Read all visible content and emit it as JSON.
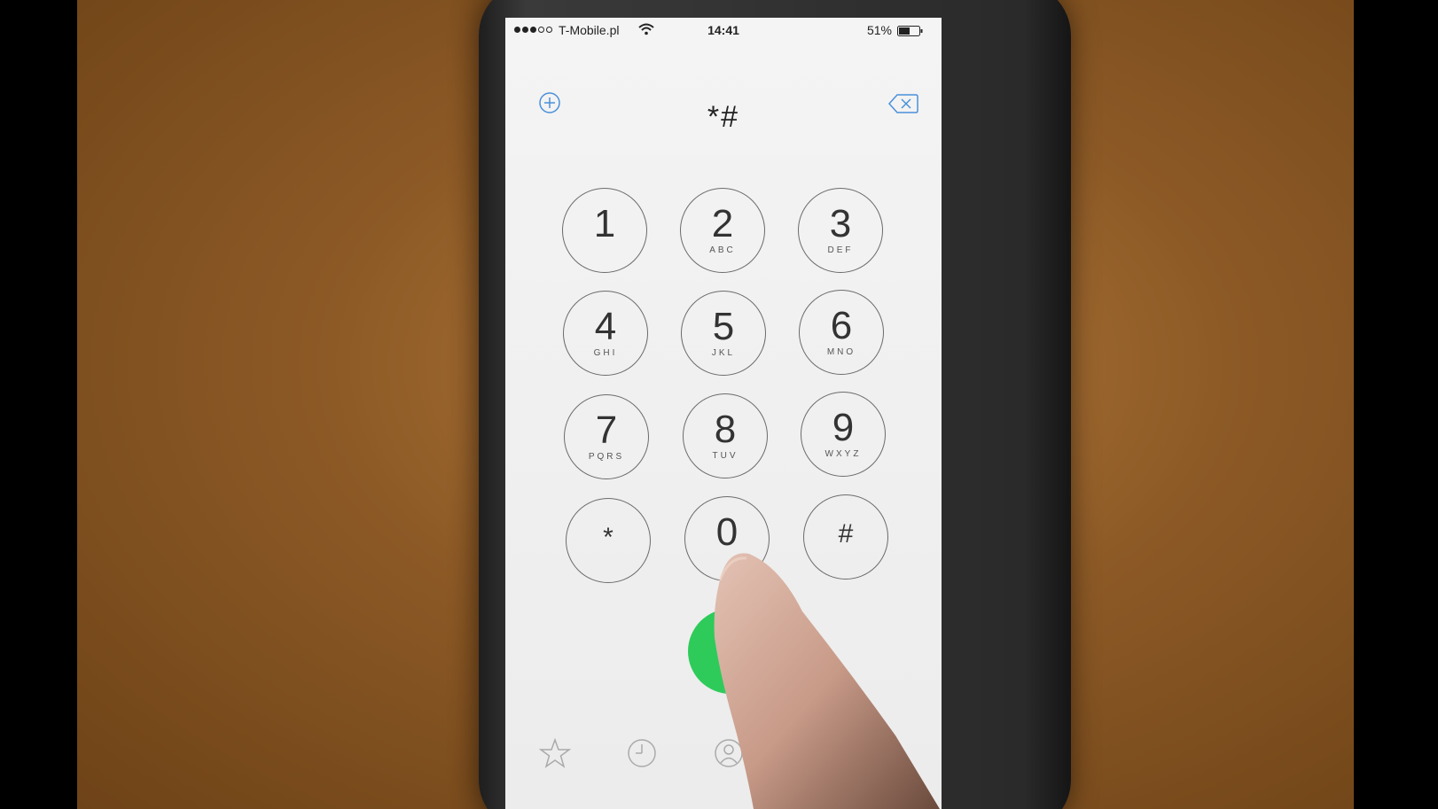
{
  "status_bar": {
    "carrier": "T-Mobile.pl",
    "time": "14:41",
    "battery": "51%"
  },
  "dialer": {
    "entered_digits": "*#",
    "keys": [
      {
        "digit": "1",
        "letters": ""
      },
      {
        "digit": "2",
        "letters": "ABC"
      },
      {
        "digit": "3",
        "letters": "DEF"
      },
      {
        "digit": "4",
        "letters": "GHI"
      },
      {
        "digit": "5",
        "letters": "JKL"
      },
      {
        "digit": "6",
        "letters": "MNO"
      },
      {
        "digit": "7",
        "letters": "PQRS"
      },
      {
        "digit": "8",
        "letters": "TUV"
      },
      {
        "digit": "9",
        "letters": "WXYZ"
      },
      {
        "digit": "*",
        "letters": ""
      },
      {
        "digit": "0",
        "letters": ""
      },
      {
        "digit": "#",
        "letters": ""
      }
    ]
  },
  "tabs": [
    {
      "icon": "star-icon",
      "label": ""
    },
    {
      "icon": "clock-icon",
      "label": ""
    },
    {
      "icon": "contacts-icon",
      "label": ""
    }
  ],
  "colors": {
    "call_button": "#2ecb5a",
    "accent_icon": "#4a90d9",
    "background": "#8d5a26"
  }
}
